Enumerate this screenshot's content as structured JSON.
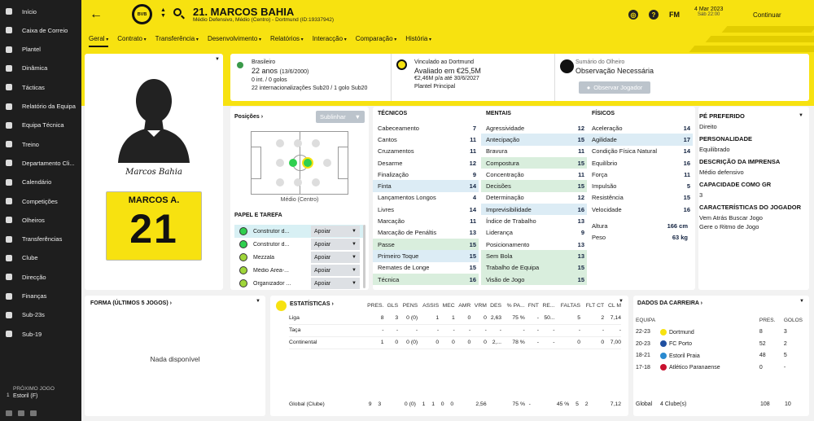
{
  "sidebar": {
    "items": [
      {
        "label": "Início",
        "icon": "home-icon"
      },
      {
        "label": "Caixa de Correio",
        "icon": "mail-icon"
      },
      {
        "label": "Plantel",
        "icon": "squad-icon"
      },
      {
        "label": "Dinâmica",
        "icon": "dynamics-icon"
      },
      {
        "label": "Tácticas",
        "icon": "tactics-icon"
      },
      {
        "label": "Relatório da Equipa",
        "icon": "report-icon"
      },
      {
        "label": "Equipa Técnica",
        "icon": "staff-icon"
      },
      {
        "label": "Treino",
        "icon": "training-icon"
      },
      {
        "label": "Departamento Cli...",
        "icon": "medical-icon"
      },
      {
        "label": "Calendário",
        "icon": "calendar-icon"
      },
      {
        "label": "Competições",
        "icon": "trophy-icon"
      },
      {
        "label": "Olheiros",
        "icon": "scout-icon"
      },
      {
        "label": "Transferências",
        "icon": "transfer-icon"
      },
      {
        "label": "Clube",
        "icon": "club-icon"
      },
      {
        "label": "Direcção",
        "icon": "board-icon"
      },
      {
        "label": "Finanças",
        "icon": "finance-icon"
      },
      {
        "label": "Sub-23s",
        "icon": "u23-icon"
      },
      {
        "label": "Sub-19",
        "icon": "u19-icon"
      }
    ],
    "next_match": {
      "label": "PRÓXIMO JOGO",
      "number": "1",
      "team": "Estoril (F)"
    }
  },
  "header": {
    "club_badge": "BVB",
    "player_title": "21. MARCOS BAHIA",
    "player_sub": "Médio Defensivo, Médio (Centro) - Dortmund (ID:19337942)",
    "date": "4 Mar 2023",
    "day_time": "Sáb 22:00",
    "continue": "Continuar",
    "fm": "FM",
    "help": "?"
  },
  "nav": {
    "tabs": [
      "Geral",
      "Contrato",
      "Transferência",
      "Desenvolvimento",
      "Relatórios",
      "Interacção",
      "Comparação",
      "História"
    ]
  },
  "profile": {
    "signature": "Marcos Bahia",
    "shirt_name": "MARCOS A.",
    "shirt_number": "21"
  },
  "info": {
    "nationality": "Brasileiro",
    "age": "22 anos",
    "dob": "(13/6/2000)",
    "intl": "0 int. / 0 golos",
    "u20": "22 internacionalizações Sub20 / 1 golo Sub20",
    "contract_label": "Vinculado ao Dortmund",
    "value": "Avaliado em €25,5M",
    "wage": "€2,46M p/a até 30/6/2027",
    "squad_status": "Plantel Principal",
    "scout_label": "Sumário do Olheiro",
    "scout_value": "Observação Necessária",
    "scout_button": "Observar Jogador"
  },
  "positions": {
    "title": "Posições",
    "button": "Sublinhar",
    "caption": "Médio (Centro)",
    "role_title": "PAPEL E TAREFA",
    "roles": [
      {
        "name": "Construtor d...",
        "duty": "Apoiar",
        "color": "#2fcf4f"
      },
      {
        "name": "Construtor d...",
        "duty": "Apoiar",
        "color": "#2fcf4f"
      },
      {
        "name": "Mezzala",
        "duty": "Apoiar",
        "color": "#9fd63a"
      },
      {
        "name": "Médio Área-...",
        "duty": "Apoiar",
        "color": "#9fd63a"
      },
      {
        "name": "Organizador ...",
        "duty": "Apoiar",
        "color": "#9fd63a"
      }
    ]
  },
  "attributes": {
    "technical_title": "TÉCNICOS",
    "technical": [
      [
        "Cabeceamento",
        "7",
        ""
      ],
      [
        "Cantos",
        "11",
        ""
      ],
      [
        "Cruzamentos",
        "11",
        ""
      ],
      [
        "Desarme",
        "12",
        ""
      ],
      [
        "Finalização",
        "9",
        ""
      ],
      [
        "Finta",
        "14",
        "bl"
      ],
      [
        "Lançamentos Longos",
        "4",
        ""
      ],
      [
        "Livres",
        "14",
        ""
      ],
      [
        "Marcação",
        "11",
        ""
      ],
      [
        "Marcação de Penáltis",
        "13",
        ""
      ],
      [
        "Passe",
        "15",
        "gr"
      ],
      [
        "Primeiro Toque",
        "15",
        "bl"
      ],
      [
        "Remates de Longe",
        "15",
        ""
      ],
      [
        "Técnica",
        "16",
        "gr"
      ]
    ],
    "mental_title": "MENTAIS",
    "mental": [
      [
        "Agressividade",
        "12",
        ""
      ],
      [
        "Antecipação",
        "15",
        "bl"
      ],
      [
        "Bravura",
        "11",
        ""
      ],
      [
        "Compostura",
        "15",
        "gr"
      ],
      [
        "Concentração",
        "11",
        ""
      ],
      [
        "Decisões",
        "15",
        "gr"
      ],
      [
        "Determinação",
        "12",
        ""
      ],
      [
        "Imprevisibilidade",
        "16",
        "bl"
      ],
      [
        "Índice de Trabalho",
        "13",
        ""
      ],
      [
        "Liderança",
        "9",
        ""
      ],
      [
        "Posicionamento",
        "13",
        ""
      ],
      [
        "Sem Bola",
        "13",
        "gr"
      ],
      [
        "Trabalho de Equipa",
        "15",
        "gr"
      ],
      [
        "Visão de Jogo",
        "15",
        "gr"
      ]
    ],
    "physical_title": "FÍSICOS",
    "physical": [
      [
        "Aceleração",
        "14",
        ""
      ],
      [
        "Agilidade",
        "17",
        "bl"
      ],
      [
        "Condição Física Natural",
        "14",
        ""
      ],
      [
        "Equilíbrio",
        "16",
        ""
      ],
      [
        "Força",
        "11",
        ""
      ],
      [
        "Impulsão",
        "5",
        ""
      ],
      [
        "Resistência",
        "15",
        ""
      ],
      [
        "Velocidade",
        "16",
        ""
      ]
    ],
    "height_label": "Altura",
    "height": "166 cm",
    "weight_label": "Peso",
    "weight": "63 kg"
  },
  "traits": [
    {
      "title": "PÉ PREFERIDO",
      "value": "Direito"
    },
    {
      "title": "PERSONALIDADE",
      "value": "Equilibrado"
    },
    {
      "title": "DESCRIÇÃO DA IMPRENSA",
      "value": "Médio defensivo"
    },
    {
      "title": "CAPACIDADE COMO GR",
      "value": "3"
    },
    {
      "title": "CARACTERÍSTICAS DO JOGADOR",
      "value": "Vem Atrás Buscar Jogo\nGere o Ritmo de Jogo"
    }
  ],
  "form": {
    "title": "FORMA (ÚLTIMOS 5 JOGOS)",
    "empty": "Nada disponível"
  },
  "stats": {
    "title": "ESTATÍSTICAS",
    "headers": [
      "PRES.",
      "GLS",
      "PENS",
      "ASSIS",
      "MEC",
      "AMR",
      "VRM",
      "DES",
      "% PA...",
      "FNT",
      "RE...",
      "FALTAS",
      "FLT CT",
      "CL M"
    ],
    "rows": [
      {
        "label": "Liga",
        "values": [
          "8",
          "3",
          "0 (0)",
          "1",
          "1",
          "0",
          "0",
          "2,63",
          "75 %",
          "-",
          "50...",
          "5",
          "2",
          "7,14"
        ]
      },
      {
        "label": "Taça",
        "values": [
          "-",
          "-",
          "-",
          "-",
          "-",
          "-",
          "-",
          "-",
          "-",
          "-",
          "-",
          "-",
          "-",
          "-"
        ]
      },
      {
        "label": "Continental",
        "values": [
          "1",
          "0",
          "0 (0)",
          "0",
          "0",
          "0",
          "0",
          "2,...",
          "78 %",
          "-",
          "-",
          "0",
          "0",
          "7,00"
        ]
      }
    ],
    "total": {
      "label": "Global (Clube)",
      "values": [
        "9",
        "3",
        "0 (0)",
        "1",
        "1",
        "0",
        "0",
        "2,56",
        "75 %",
        "-",
        "45 %",
        "5",
        "2",
        "7,12"
      ]
    }
  },
  "career": {
    "title": "DADOS DA CARREIRA",
    "headers": [
      "EQUIPA",
      "PRES.",
      "GOLOS"
    ],
    "rows": [
      {
        "season": "22-23",
        "team": "Dortmund",
        "apps": "8",
        "goals": "3",
        "color": "#f7e210"
      },
      {
        "season": "20-23",
        "team": "FC Porto",
        "apps": "52",
        "goals": "2",
        "color": "#1f4fa0"
      },
      {
        "season": "18-21",
        "team": "Estoril Praia",
        "apps": "48",
        "goals": "5",
        "color": "#2a8ad0"
      },
      {
        "season": "17-18",
        "team": "Atlético Paranaense",
        "apps": "0",
        "goals": "-",
        "color": "#c8102e"
      }
    ],
    "total": {
      "label": "Global",
      "clubs": "4 Clube(s)",
      "apps": "108",
      "goals": "10"
    }
  }
}
